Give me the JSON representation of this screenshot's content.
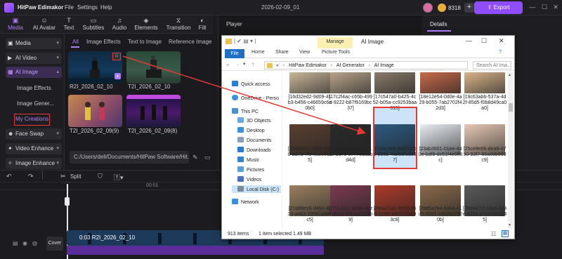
{
  "app": {
    "name": "HitPaw Edimakor",
    "menus": [
      "File",
      "Settings",
      "Help"
    ],
    "project_title": "2026-02-09_01",
    "credits": "8318",
    "export_label": "Export"
  },
  "toolbar": {
    "tools": [
      {
        "label": "Media",
        "icon": "media-icon",
        "active": true
      },
      {
        "label": "AI Avatar",
        "icon": "ai-avatar-icon",
        "active": false
      },
      {
        "label": "Text",
        "icon": "text-icon",
        "active": false
      },
      {
        "label": "Subtitles",
        "icon": "subtitles-icon",
        "active": false
      },
      {
        "label": "Audio",
        "icon": "audio-icon",
        "active": false
      },
      {
        "label": "Elements",
        "icon": "elements-icon",
        "active": false
      },
      {
        "label": "Transition",
        "icon": "transition-icon",
        "active": false
      },
      {
        "label": "Filt",
        "icon": "filter-icon",
        "active": false
      }
    ]
  },
  "sidebar": {
    "items": [
      {
        "label": "Media"
      },
      {
        "label": "AI Video"
      },
      {
        "label": "AI Image"
      },
      {
        "label": "Face Swap"
      },
      {
        "label": "Video Enhance"
      },
      {
        "label": "Image Enhance"
      }
    ],
    "sub_items": [
      "Image Effects",
      "Image Gener...",
      "My Creations"
    ]
  },
  "ai_tabs": [
    "All",
    "Image Effects",
    "Text to Image",
    "Reference Image"
  ],
  "thumbnails": [
    "R2I_2026_02_10",
    "T2I_2026_02_10",
    "T2I_2026_02_09(9)",
    "T2I_2026_02_09(8)"
  ],
  "path": "C:/Users/dell/Documents/HitPaw Software/Hit...",
  "player": {
    "label": "Player"
  },
  "details": {
    "label": "Details"
  },
  "timeline": {
    "split_label": "Split",
    "time_mark": "00:01",
    "clip_label": "0:03  R2I_2026_02_10",
    "cover_label": "Cover"
  },
  "explorer": {
    "title": "AI Image",
    "manage_label": "Manage",
    "ribbon_tabs": [
      "File",
      "Home",
      "Share",
      "View",
      "Picture Tools"
    ],
    "address": [
      "«",
      "HitPaw Edimakor",
      "AI Generator",
      "AI Image"
    ],
    "search_placeholder": "Search AI Ima...",
    "nav": [
      "Quick access",
      "OneDrive - Perso",
      "This PC",
      "3D Objects",
      "Desktop",
      "Documents",
      "Downloads",
      "Music",
      "Pictures",
      "Videos",
      "Local Disk (C:)",
      "Network"
    ],
    "files": [
      {
        "name": "[16d32ed2-9d09-41b3-b456-c46659c6d0b0]",
        "color": "#c9b79a"
      },
      {
        "name": "[17c2f4ac-c65b-499a-9222-b87f9169bc37]",
        "color": "#b9a48a"
      },
      {
        "name": "[17c547a0-b425-4c52-b05a-cc9253baa315]",
        "color": "#8a7a6a"
      },
      {
        "name": "[18e12e54-0d0e-4a29-b055-7ab2702f42d3]",
        "color": "#c86a4a"
      },
      {
        "name": "[19c63abb-537a-4d2f-85d5-f0b8d49ca0a0]",
        "color": "#d9b48a"
      },
      {
        "name": "[20b0edc7-5d2f-4090-ad7a-7f946afe8c15]",
        "color": "#5a4030"
      },
      {
        "name": "[21c94867-034e-41ae-b376-e7778ddabd4d]",
        "color": "#2a2a2a"
      },
      {
        "name": "[22a5c9c6-9d2f-4cb1-998b-4faf1df1d307]",
        "color": "#2c5a80"
      },
      {
        "name": "[23ab3601-01ee-440e-bdf8-dc61f4e0ff8c]",
        "color": "#e8eef4"
      },
      {
        "name": "[25ce9e06-dea9-4750-93f7-95a06b959c9]",
        "color": "#e6c8b4"
      },
      {
        "name": "[27a98e16-3454-4033-a462-20562a4e3c5]",
        "color": "#9a8060"
      },
      {
        "name": "[27f1d22c-9e6b-4be5-8b4b-f89caa1f19b9]",
        "color": "#7a3a50"
      },
      {
        "name": "[28aa71d2-6959-450f-bc66-e40717ab93c8]",
        "color": "#b03a2a"
      },
      {
        "name": "[28d5a7e4-6404-41d5-8261-ceb20c2920b]",
        "color": "#8a6a4a"
      },
      {
        "name": "[29b047cf-18a9-434e-826a-873819cd845]",
        "color": "#5a5a5a"
      }
    ],
    "status": {
      "count": "913 items",
      "selected": "1 item selected  1.49 MB"
    }
  }
}
